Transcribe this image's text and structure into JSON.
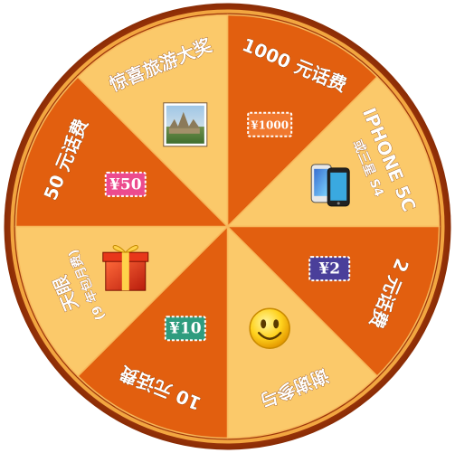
{
  "wheel": {
    "colors": {
      "rim_outer": "#b8400c",
      "rim_inner": "#f2a640",
      "segment_dark": "#e25f0f",
      "segment_light": "#fbc96a"
    },
    "segments": [
      {
        "label": "1000 元话费",
        "badge": "¥1000",
        "badge_color": "#f0782e",
        "icon": "phone-credit-badge-icon"
      },
      {
        "label": "IPHONE 5C",
        "sublabel": "或三星 S4",
        "icon": "smartphone-icon"
      },
      {
        "label": "2 元话费",
        "badge": "¥2",
        "badge_color": "#4a3f9a",
        "icon": "phone-credit-badge-icon"
      },
      {
        "label": "谢谢参与",
        "icon": "smiley-face-icon"
      },
      {
        "label": "10 元话费",
        "badge": "¥10",
        "badge_color": "#2f9c7e",
        "icon": "phone-credit-badge-icon"
      },
      {
        "label": "天眼",
        "sublabel": "(9 年包月费)",
        "icon": "gift-box-icon"
      },
      {
        "label": "50 元话费",
        "badge": "¥50",
        "badge_color": "#ec4b8e",
        "icon": "phone-credit-badge-icon"
      },
      {
        "label": "惊喜旅游大奖",
        "icon": "travel-photo-icon"
      }
    ]
  }
}
